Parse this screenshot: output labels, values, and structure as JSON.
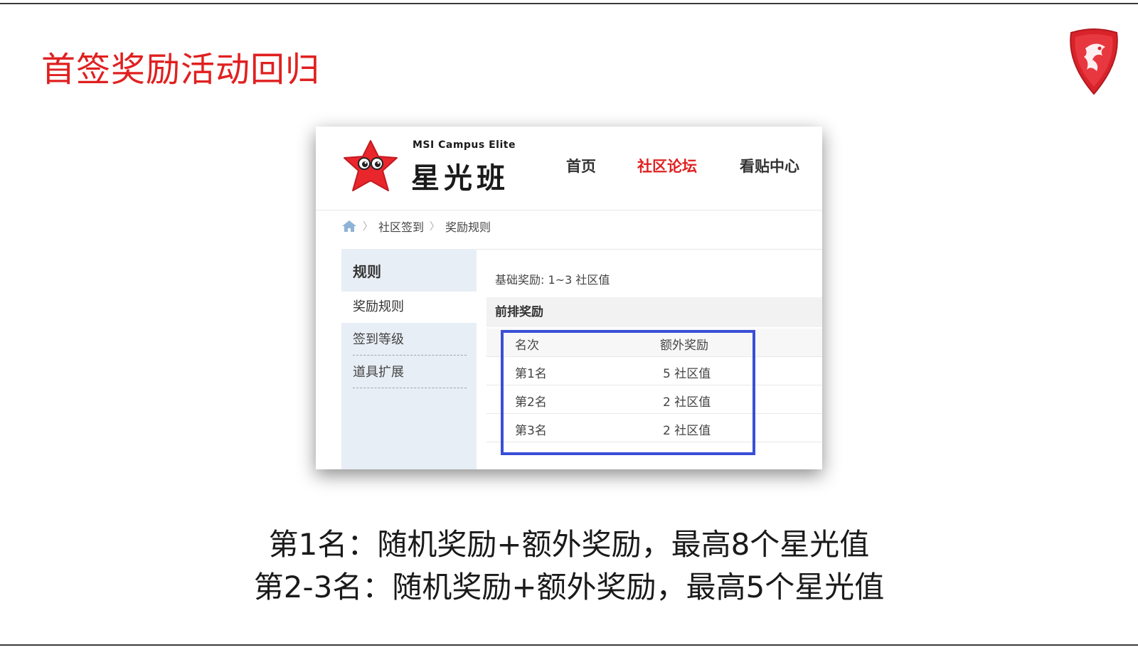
{
  "slide": {
    "title": "首签奖励活动回归",
    "logo": "msi-dragon-shield-icon",
    "accent": "#e02020"
  },
  "site": {
    "brand_sub": "MSI Campus Elite",
    "brand_name": "星光班",
    "mascot": "red-star-mascot-icon",
    "nav": [
      {
        "label": "首页",
        "active": false
      },
      {
        "label": "社区论坛",
        "active": true
      },
      {
        "label": "看贴中心",
        "active": false
      }
    ]
  },
  "breadcrumb": {
    "home_icon": "home-icon",
    "items": [
      "社区签到",
      "奖励规则"
    ]
  },
  "sidebar": {
    "title": "规则",
    "items": [
      {
        "label": "奖励规则",
        "active": true
      },
      {
        "label": "签到等级",
        "active": false
      },
      {
        "label": "道具扩展",
        "active": false
      }
    ]
  },
  "content": {
    "base_reward": "基础奖励: 1~3 社区值",
    "section_title": "前排奖励",
    "table": {
      "headers": [
        "名次",
        "额外奖励"
      ],
      "rows": [
        [
          "第1名",
          "5 社区值"
        ],
        [
          "第2名",
          "2 社区值"
        ],
        [
          "第3名",
          "2 社区值"
        ]
      ]
    },
    "highlight_color": "#3a4fd6"
  },
  "captions": [
    "第1名：随机奖励+额外奖励，最高8个星光值",
    "第2-3名：随机奖励+额外奖励，最高5个星光值"
  ]
}
